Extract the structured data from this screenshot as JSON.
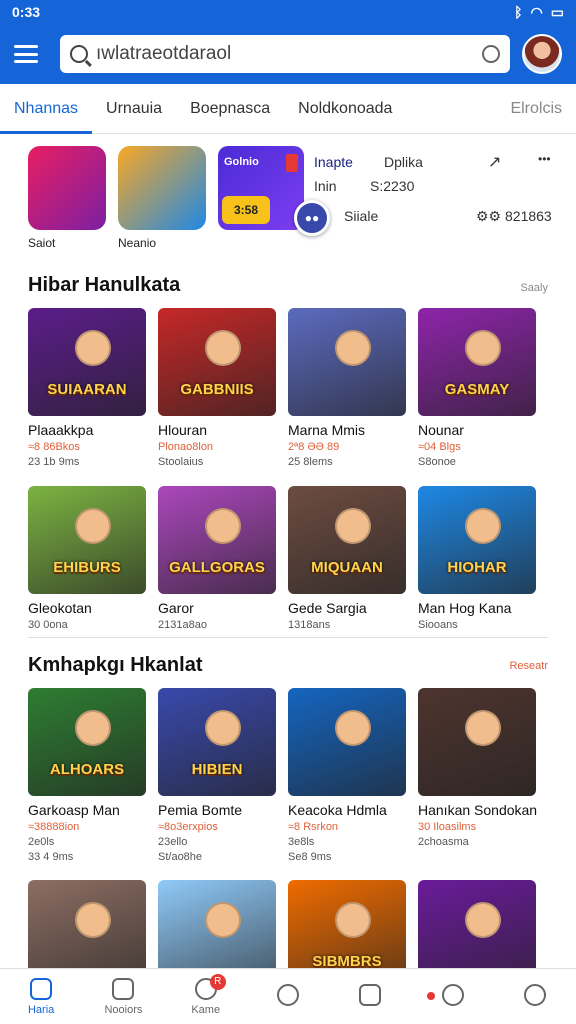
{
  "status_bar": {
    "time": "0:33"
  },
  "search": {
    "value": "ıwlatraeotdaraol"
  },
  "tabs": [
    {
      "label": "Nhannas"
    },
    {
      "label": "Urnauia"
    },
    {
      "label": "Boepnasca"
    },
    {
      "label": "Noldkonoada"
    },
    {
      "label": "Elrolcis"
    }
  ],
  "featured": {
    "items": [
      {
        "label": "Saiot",
        "color": "#c2185b"
      },
      {
        "label": "Neanio",
        "color": "#1e88e5"
      }
    ],
    "promo": {
      "badge": "Golnio",
      "count": "3:58",
      "fab": "●●"
    },
    "meta": {
      "title": "Inapte",
      "title2": "Dplika",
      "size_label": "Inin",
      "size_value": "S:2230",
      "rating_label": "Siiale",
      "downloads": "⚙⚙ 821863",
      "share_glyph": "↗",
      "more_glyph": "•••"
    }
  },
  "section1": {
    "title": "Hibar Hanulkata",
    "link": "Saaly",
    "cards": [
      {
        "name": "Plaaakkpa",
        "price": "≈8 86Bkos",
        "sub": "23 1b 9ms",
        "word": "SUIAARAN",
        "bg": "#5b1d8a"
      },
      {
        "name": "Hlouran",
        "price": "Plonao8lon",
        "sub": "Stoolaius",
        "word": "GABBNIIS",
        "bg": "#c62828"
      },
      {
        "name": "Marna Mmis",
        "price": "2ª8 ƏƏ 89",
        "sub": "25 8lems",
        "word": "",
        "bg": "#5c6bc0"
      },
      {
        "name": "Nounar",
        "price": "≈04 Blgs",
        "sub": "S8onoe",
        "word": "GASMAY",
        "bg": "#8e24aa"
      },
      {
        "name": "Gleokotan",
        "price": "",
        "sub": "30 0ona",
        "word": "EHIBURS",
        "bg": "#7cb342"
      },
      {
        "name": "Garor",
        "price": "",
        "sub": "2131a8ao",
        "word": "GALLGORAS",
        "bg": "#ab47bc"
      },
      {
        "name": "Gede Sargia",
        "price": "",
        "sub": "1318ans",
        "word": "MIQUAAN",
        "bg": "#6d4c41"
      },
      {
        "name": "Man Hog Kana",
        "price": "",
        "sub": "Siooans",
        "word": "HIOHAR",
        "bg": "#1e88e5"
      }
    ]
  },
  "section2": {
    "title": "Kmhapkgı Hkanlat",
    "link": "Reseatr",
    "cards": [
      {
        "name": "Garkoasp Man",
        "price": "≈38888ion",
        "sub": "2e0ls",
        "sub2": "33 4 9ms",
        "word": "ALHOARS",
        "bg": "#2e7d32"
      },
      {
        "name": "Pemia Bomte",
        "price": "≈8o3erxpios",
        "sub": "23ello",
        "sub2": "St/ao8he",
        "word": "HIBIEN",
        "bg": "#3949ab"
      },
      {
        "name": "Keacoka Hdmla",
        "price": "≈8 Rsrkon",
        "sub": "3e8ls",
        "sub2": "Se8 9ms",
        "word": "",
        "bg": "#1565c0"
      },
      {
        "name": "Hanıkan Sondokan",
        "price": "30 Iloasilms",
        "sub": "2choasma",
        "sub2": "",
        "word": "",
        "bg": "#4e342e"
      },
      {
        "name": "",
        "price": "",
        "sub": "",
        "sub2": "",
        "word": "",
        "bg": "#8d6e63"
      },
      {
        "name": "",
        "price": "",
        "sub": "",
        "sub2": "",
        "word": "",
        "bg": "#90caf9"
      },
      {
        "name": "",
        "price": "",
        "sub": "",
        "sub2": "",
        "word": "SIBMBRS",
        "bg": "#ef6c00"
      },
      {
        "name": "",
        "price": "",
        "sub": "",
        "sub2": "",
        "word": "",
        "bg": "#6a1b9a"
      }
    ]
  },
  "bottom_nav": [
    {
      "label": "Haria",
      "active": true,
      "badge": ""
    },
    {
      "label": "Nooiors",
      "active": false,
      "badge": ""
    },
    {
      "label": "Kame",
      "active": false,
      "badge": "R"
    },
    {
      "label": "",
      "active": false,
      "badge": ""
    },
    {
      "label": "",
      "active": false,
      "badge": ""
    },
    {
      "label": "",
      "active": false,
      "badge": ""
    },
    {
      "label": "",
      "active": false,
      "badge": ""
    }
  ],
  "colors": {
    "brand": "#1565d8",
    "price": "#e0603a"
  }
}
